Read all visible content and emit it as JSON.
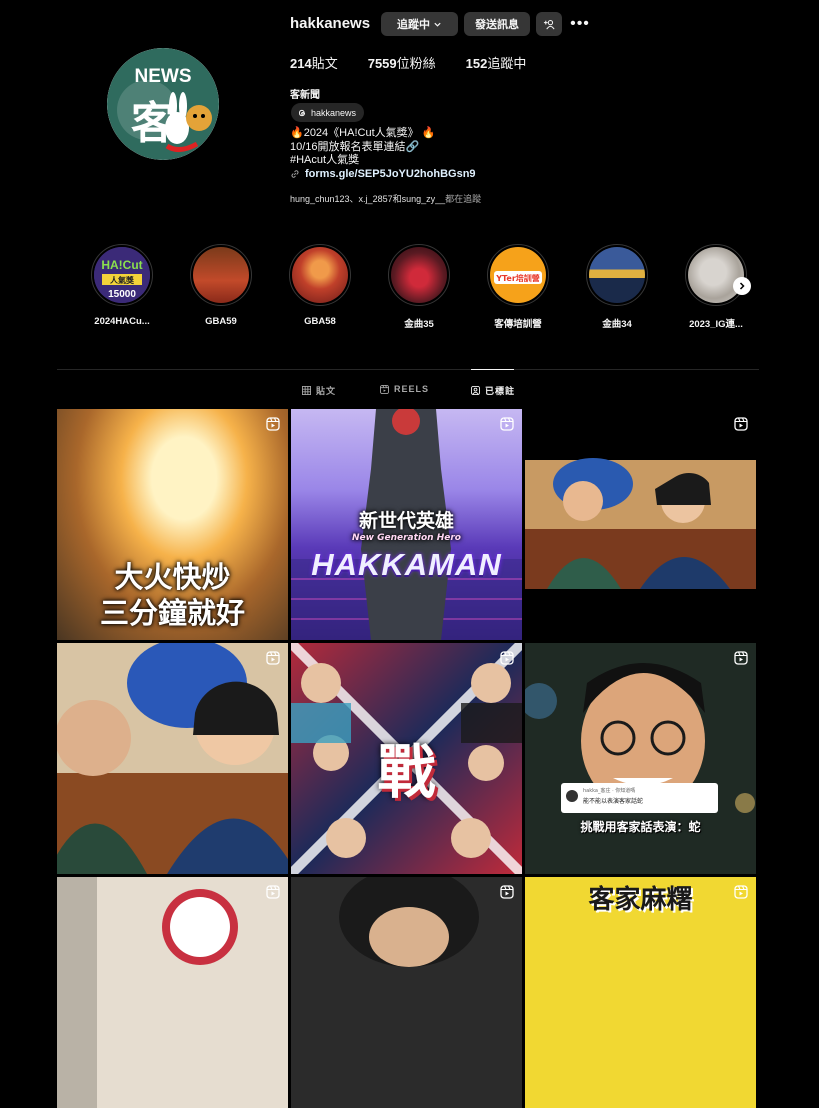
{
  "profile": {
    "username": "hakkanews",
    "following_btn": "追蹤中",
    "message_btn": "發送訊息",
    "stats": {
      "posts": "214",
      "posts_label": "貼文",
      "followers": "7559",
      "followers_label": "位粉絲",
      "following": "152",
      "following_label": "追蹤中"
    },
    "full_name": "客新聞",
    "threads_handle": "hakkanews",
    "bio_lines": [
      "🔥2024《HA!Cut人氣獎》 🔥",
      "10/16開放報名表單連結🔗",
      "#HAcut人氣獎"
    ],
    "link": "forms.gle/SEP5JoYU2hohBGsn9",
    "followed_by": {
      "names": "hung_chun123、x.j_2857和sung_zy__",
      "suffix": "都在追蹤"
    },
    "avatar_text": {
      "news": "NEWS",
      "hakka": "客"
    }
  },
  "highlights": [
    {
      "label": "2024HACu...",
      "art": "HA!Cut 人氣獎 15000"
    },
    {
      "label": "GBA59"
    },
    {
      "label": "GBA58"
    },
    {
      "label": "金曲35"
    },
    {
      "label": "客傳培訓營",
      "art": "YTer培訓營"
    },
    {
      "label": "金曲34"
    },
    {
      "label": "2023_IG連..."
    }
  ],
  "tabs": [
    {
      "label": "貼文",
      "icon": "grid-icon"
    },
    {
      "label": "REELS",
      "icon": "reels-icon"
    },
    {
      "label": "已標註",
      "icon": "tagged-icon",
      "active": true
    }
  ],
  "posts": [
    {
      "caption_lines": [
        "大火快炒",
        "三分鐘就好"
      ]
    },
    {
      "title": "新世代英雄",
      "subtitle": "New Generation Hero",
      "brand": "HAKKAMAN"
    },
    {},
    {},
    {
      "caption": "戰"
    },
    {
      "comment_user": "hakka_客庄 · 你知道嗎",
      "comment_text": "能不能以表演客家話蛇",
      "caption": "挑戰用客家話表演：蛇"
    },
    {},
    {},
    {
      "caption": "客家麻糬"
    }
  ],
  "colors": {
    "bg": "#000000",
    "button": "#363636",
    "link": "#e0f1ff",
    "muted": "#a8a8a8",
    "divider": "#262626"
  }
}
